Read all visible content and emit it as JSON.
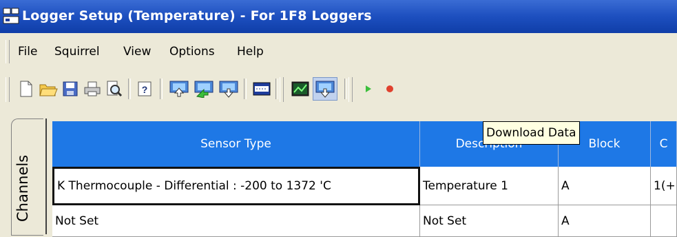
{
  "window": {
    "title": "Logger Setup (Temperature) - For 1F8 Loggers"
  },
  "menu": [
    "File",
    "Squirrel",
    "View",
    "Options",
    "Help"
  ],
  "toolbar": {
    "buttons": [
      "new-file-icon",
      "open-folder-icon",
      "save-icon",
      "print-icon",
      "print-preview-icon",
      "help-icon",
      "upload-icon",
      "send-to-logger-icon",
      "download-from-logger-icon",
      "display-icon",
      "graph-icon",
      "download-data-icon",
      "play-icon",
      "record-icon"
    ],
    "tooltip": "Download Data"
  },
  "tabs": {
    "channels": "Channels"
  },
  "grid": {
    "columns": [
      "Sensor Type",
      "Description",
      "Block",
      "C"
    ],
    "rows": [
      [
        "K Thermocouple - Differential : -200  to 1372 'C",
        "Temperature 1",
        "A",
        "1(+"
      ],
      [
        "Not Set",
        "Not Set",
        "A",
        ""
      ]
    ]
  }
}
